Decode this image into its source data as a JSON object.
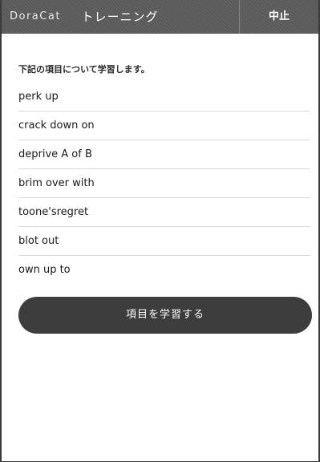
{
  "header": {
    "brand": "DoraCat",
    "title": "トレーニング",
    "stop_label": "中止"
  },
  "main": {
    "intro": "下記の項目について学習します。",
    "items": [
      {
        "label": "perk up"
      },
      {
        "label": "crack down on"
      },
      {
        "label": "deprive A of B"
      },
      {
        "label": "brim over with"
      },
      {
        "label": "toone'sregret"
      },
      {
        "label": "blot out"
      },
      {
        "label": "own up to"
      }
    ],
    "learn_label": "項目を学習する"
  },
  "colors": {
    "header_bg": "#5a5a5a",
    "button_bg": "#3d3d3d",
    "divider": "#d9d9d9"
  }
}
